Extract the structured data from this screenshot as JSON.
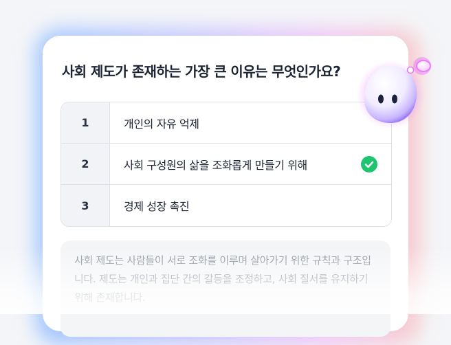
{
  "quiz": {
    "question": "사회 제도가 존재하는 가장 큰 이유는 무엇인가요?",
    "options": [
      {
        "number": "1",
        "text": "개인의 자유 억제",
        "correct": false
      },
      {
        "number": "2",
        "text": "사회 구성원의 삶을 조화롭게 만들기 위해",
        "correct": true
      },
      {
        "number": "3",
        "text": "경제 성장 촉진",
        "correct": false
      }
    ],
    "explanation": "사회 제도는 사람들이 서로 조화를 이루며 살아가기 위한 규칙과 구조입니다. 제도는 개인과 집단 간의 갈등을 조정하고, 사회 질서를 유지하기 위해 존재합니다."
  },
  "icons": {
    "correct": "check-circle-icon",
    "mascot": "mascot-icon"
  },
  "colors": {
    "correct_green": "#1fc46e",
    "question_text": "#1c2333",
    "explanation_text": "#8d939e",
    "glow_blue": "#9cc4ff",
    "glow_pink": "#f0c2f6"
  }
}
